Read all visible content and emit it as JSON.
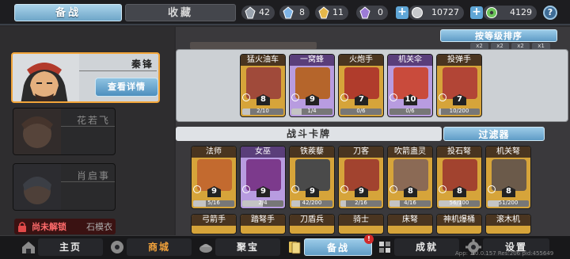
{
  "header": {
    "tab_active": "备战",
    "tab_inactive": "收藏",
    "resources": [
      {
        "icon": "silver-shard-icon",
        "value": "42",
        "color": "#9aa3ae"
      },
      {
        "icon": "blue-shard-icon",
        "value": "8",
        "color": "#7fb4e6"
      },
      {
        "icon": "gold-shard-icon",
        "value": "11",
        "color": "#e6b84a"
      },
      {
        "icon": "purple-shard-icon",
        "value": "0",
        "color": "#9c7bd6"
      }
    ],
    "currency_gold": "10727",
    "currency_gem": "4129"
  },
  "sort_button": "按等级排序",
  "multipliers": [
    "x2",
    "x2",
    "x2",
    "x1"
  ],
  "heroes": {
    "selected_name": "秦锋",
    "details_button": "查看详情",
    "list": [
      {
        "name": "花若飞"
      },
      {
        "name": "肖启事"
      }
    ],
    "locked_label": "尚未解锁",
    "locked_name": "石模衣"
  },
  "deck_cards": [
    {
      "name": "猛火油车",
      "cost": "8",
      "progress": "2/10",
      "level": 0.2,
      "color": "gold",
      "art": "#a04a3a"
    },
    {
      "name": "一窝蜂",
      "cost": "9",
      "progress": "1/4",
      "level": 0.25,
      "color": "purple",
      "art": "#b5652b"
    },
    {
      "name": "火炮手",
      "cost": "7",
      "progress": "0/6",
      "level": 0.0,
      "color": "gold",
      "art": "#b03c2c"
    },
    {
      "name": "机关伞",
      "cost": "10",
      "progress": "0/6",
      "level": 0.0,
      "color": "purple",
      "art": "#c94b3c"
    },
    {
      "name": "投弹手",
      "cost": "7",
      "progress": "10/200",
      "level": 0.05,
      "color": "gold",
      "art": "#b24536"
    }
  ],
  "section_title": "战斗卡牌",
  "filter_button": "过滤器",
  "battle_cards": [
    {
      "name": "法师",
      "cost": "9",
      "progress": "5/16",
      "level": 0.31,
      "color": "gold",
      "art": "#c36a2f"
    },
    {
      "name": "女巫",
      "cost": "9",
      "progress": "2/4",
      "level": 0.5,
      "color": "purple",
      "art": "#7c3a8c"
    },
    {
      "name": "铁蒺藜",
      "cost": "9",
      "progress": "42/200",
      "level": 0.21,
      "color": "gold",
      "art": "#4a4a4a"
    },
    {
      "name": "刀客",
      "cost": "9",
      "progress": "2/16",
      "level": 0.13,
      "color": "gold",
      "art": "#a2432f"
    },
    {
      "name": "吹箭蛊灵",
      "cost": "8",
      "progress": "4/16",
      "level": 0.25,
      "color": "gold",
      "art": "#8b6a55"
    },
    {
      "name": "投石弩",
      "cost": "8",
      "progress": "56/100",
      "level": 0.56,
      "color": "gold",
      "art": "#a2432f"
    },
    {
      "name": "机关弩",
      "cost": "8",
      "progress": "51/200",
      "level": 0.26,
      "color": "gold",
      "art": "#6b5a4a"
    }
  ],
  "partial_cards": [
    "弓箭手",
    "踏弩手",
    "刀盾兵",
    "骑士",
    "床弩",
    "神机爆桶",
    "滚木机"
  ],
  "bottom_nav": [
    {
      "label": "主页"
    },
    {
      "label": "商城"
    },
    {
      "label": "聚宝"
    },
    {
      "label": "备战"
    },
    {
      "label": "成就"
    },
    {
      "label": "设置"
    }
  ],
  "nav_badge": "!",
  "app_info": "App: 1.0.0.157 Res:206 pid:455649"
}
